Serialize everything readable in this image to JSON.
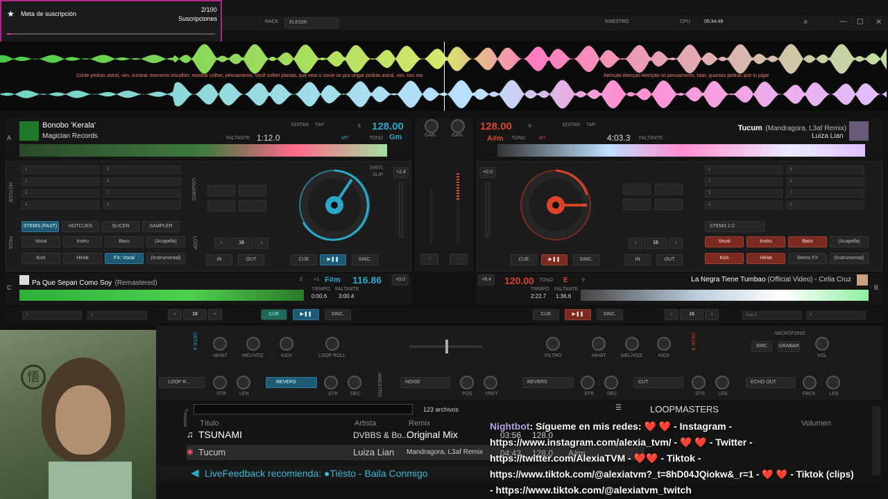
{
  "overlay": {
    "goal_title": "Meta de suscripción",
    "goal_count": "2/100",
    "goal_unit": "Suscripciones",
    "goal_progress": 0.02
  },
  "topbar": {
    "rack": "RACK",
    "rack_value": "ELEGIR",
    "master": "MAESTRO",
    "cpu": "CPU",
    "clock": "05:34:49"
  },
  "lyrics": {
    "left": "Conte pedras astral, vim, mostrar momento escolher, mostrar colher, pensamento, Você colher plantar, que vem o nome se pra vingar pedras astral, vim, seu ma",
    "right": "Atenção Atenção Atenção no pensamento, falar,     quantas     pedras     que     tu     jogar"
  },
  "deckA": {
    "letter": "A",
    "title": "Bonobo 'Kerala'",
    "artist": "Magician Records",
    "remaining_label": "FALTANTE",
    "remaining": "1:12.0",
    "bpm": "128.00",
    "key": "Gm",
    "key_num": "6",
    "edit": "EDITAR",
    "tap": "TAP",
    "mt": "MT",
    "tone": "TONO",
    "pitch": "+2.4",
    "master_sync": "MAESTRO SINC.",
    "hotcue": "HOTCUE",
    "user": "USUARIO",
    "pads": "PADS",
    "loop": "LOOP",
    "loop_len": "16",
    "in": "IN",
    "out": "OUT",
    "cue": "CUE",
    "sync": "SINC.",
    "vinyl": "VINYL",
    "slip": "SLIP",
    "pad_tabs": [
      "STEMS (FAST)",
      "HOTCUES",
      "SLICER",
      "SAMPLER"
    ],
    "pads_list": [
      "Vocal",
      "Instru",
      "Bass",
      "(Acapella)",
      "Kick",
      "HiHat",
      "FX: Vocal",
      "(Instrumental)"
    ],
    "hotcues": [
      "1",
      "2",
      "3",
      "4",
      "5",
      "6",
      "7",
      "8"
    ]
  },
  "deckB": {
    "letter": "B",
    "title": "Tucum",
    "title_extra": "(Mandragora, L3af Remix)",
    "artist": "Luiza Lian",
    "remaining_label": "FALTANTE",
    "remaining": "4:03.3",
    "bpm": "128.00",
    "key": "A#m",
    "key_num": "6",
    "edit": "EDITAR",
    "tap": "TAP",
    "mt": "MT",
    "tone": "TONO",
    "pitch": "+0.0",
    "master_sync": "MAESTRO SINC.",
    "pad_tab": "STEMS 2.0",
    "pads_list": [
      "Vocal",
      "Instru",
      "Bass",
      "(Acapella)",
      "Kick",
      "HiHat",
      "Stems FX",
      "(Instrumental)"
    ],
    "loop_len": "16",
    "in": "IN",
    "out": "OUT",
    "cue": "CUE",
    "sync": "SINC."
  },
  "deckC": {
    "letter": "C",
    "title": "Pa Que Sepan Como Soy",
    "title_extra": "(Remastered)",
    "bpm": "116.86",
    "key": "F#m",
    "key_num": "2",
    "pitch_off": "+1",
    "time_label": "TIEMPO",
    "time": "0:00.6",
    "remaining_label": "FALTANTE",
    "remaining": "3:00.4",
    "pitch": "+0.0",
    "loop_len": "16",
    "cue": "CUE",
    "sync": "SINC.",
    "slots": [
      "1",
      "2"
    ]
  },
  "deckD": {
    "letter": "B",
    "title": "La Negra Tiene Tumbao",
    "title_extra": "(Official Video) - Celia Cruz",
    "bpm": "120.00",
    "key": "E",
    "key_num": "9",
    "tone": "TONO",
    "pitch": "+8.4",
    "time_label": "TIEMPO",
    "time": "2:22.7",
    "remaining_label": "FALTANTE",
    "remaining": "1:36.6",
    "loop_len": "16",
    "cue": "CUE",
    "sync": "SINC.",
    "slots": [
      "Cue 1",
      "2"
    ]
  },
  "mixer": {
    "gain": "GAN."
  },
  "fx": {
    "left_title": "DECK A",
    "right_title": "DECK B",
    "hihat": "HIHAT",
    "melvoz": "MEL/VOZ",
    "kick": "KICK",
    "loop_roll": "LOOP ROLL",
    "filtro": "FILTRO",
    "microfono": "MICRÓFONO",
    "emc": "EMC",
    "grabar": "GRABAR",
    "vol": "VOL",
    "loop_r": "LOOP R...",
    "revers": "REVERS",
    "str": "STR",
    "len": "LEN",
    "dec": "DEC",
    "noise": "NOISE",
    "pos": "POS",
    "yret": "YRET",
    "maestro": "MAESTRO",
    "cut": "CUT",
    "echo_out": "ECHO OUT",
    "fbck": "FBCK"
  },
  "browser": {
    "count": "123 archivos",
    "col_title": "Título",
    "col_artist": "Artista",
    "col_remix": "Remix",
    "col_volume": "Volumen",
    "rows": [
      {
        "title": "TSUNAMI",
        "artist": "DVBBS & Bo...",
        "remix": "Original Mix",
        "time": "03:56",
        "bpm": "128.0"
      },
      {
        "title": "Tucum",
        "artist": "Luiza Lian",
        "remix": "Mandragora, L3af Remix",
        "time": "04:43",
        "bpm": "128.0",
        "key": "A#m"
      }
    ],
    "feedback": "LiveFeedback recomienda: ●Tiësto - Baila Conmigo",
    "loopmasters": "LOOPMASTERS",
    "sidebar": "Historial"
  },
  "chat": {
    "user": "Nightbot",
    "line1": ": Sígueme en mis redes: ❤️ ❤️ - Instagram -",
    "line2": "https://www.instagram.com/alexia_tvm/ - ❤️ ❤️ - Twitter -",
    "line3": "https://twitter.com/AlexiaTVM - ❤️❤️ - Tiktok -",
    "line4": "https://www.tiktok.com/@alexiatvm?_t=8hD04JQiokw&_r=1 - ❤️ ❤️ - Tiktok (clips)",
    "line5": "- https://www.tiktok.com/@alexiatvm_twitch"
  },
  "colors": {
    "accent_blue": "#2aa7c9",
    "accent_red": "#d9442b",
    "bg": "#111111",
    "goal_border": "#b02a8a"
  }
}
